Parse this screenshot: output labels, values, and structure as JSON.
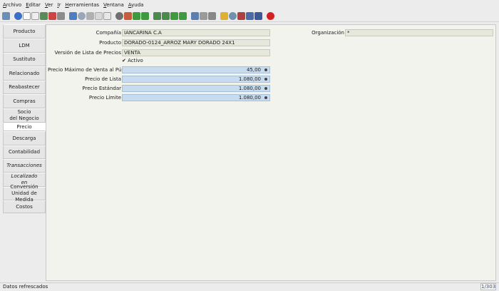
{
  "menu": [
    "Archivo",
    "Editar",
    "Ver",
    "Ir",
    "Herramientas",
    "Ventana",
    "Ayuda"
  ],
  "toolbar_icons": [
    "undo-icon",
    "help-icon",
    "new-record-icon",
    "copy-record-icon",
    "save-icon",
    "delete-icon",
    "grid-toggle-icon",
    "refresh-icon",
    "find-icon",
    "attachment-icon",
    "history-icon",
    "report-icon",
    "archive-icon",
    "home-icon",
    "prev-record-icon",
    "next-record-icon",
    "first-record-icon",
    "up-icon",
    "down-icon",
    "last-record-icon",
    "print-preview-icon",
    "print-icon",
    "print-icon-2",
    "lock-icon",
    "zoom-icon",
    "workflow-icon",
    "calculator-icon",
    "chat-icon",
    "close-window-icon"
  ],
  "tabs": [
    {
      "label": "Producto",
      "active": false
    },
    {
      "label": "LDM",
      "active": false
    },
    {
      "label": "Sustituto",
      "active": false
    },
    {
      "label": "Relacionado",
      "active": false
    },
    {
      "label": "Reabastecer",
      "active": false
    },
    {
      "label": "Compras",
      "active": false
    },
    {
      "label": "Socio\ndel Negocio",
      "active": false
    },
    {
      "label": "Precio",
      "active": true
    },
    {
      "label": "Descarga",
      "active": false
    },
    {
      "label": "Contabilidad",
      "active": false
    },
    {
      "label": "Transacciones",
      "active": false
    },
    {
      "label": "Localizado\nen",
      "active": false
    },
    {
      "label": "Conversión\nUnidad de Medida",
      "active": false
    },
    {
      "label": "Costos",
      "active": false
    }
  ],
  "form": {
    "company_label": "Compañía",
    "company_value": "IANCARINA C.A",
    "org_label": "Organización",
    "org_value": "*",
    "product_label": "Producto",
    "product_value": "DORADO-0124_ARROZ MARY DORADO 24X1",
    "pricelist_label": "Versión de Lista de Precios",
    "pricelist_value": "VENTA",
    "active_label": "Activo",
    "max_price_label": "Precio Máximo de Venta al Público",
    "max_price_value": "45,00",
    "list_price_label": "Precio de Lista",
    "list_price_value": "1.080,00",
    "std_price_label": "Precio Estándar",
    "std_price_value": "1.080,00",
    "limit_price_label": "Precio Límite",
    "limit_price_value": "1.080,00"
  },
  "status": {
    "message": "Datos refrescados",
    "record_count": "1/303"
  },
  "colors": {
    "readonly_field": "#e6e8dc",
    "number_field": "#c8dcf0",
    "panel": "#f3f3ee"
  }
}
